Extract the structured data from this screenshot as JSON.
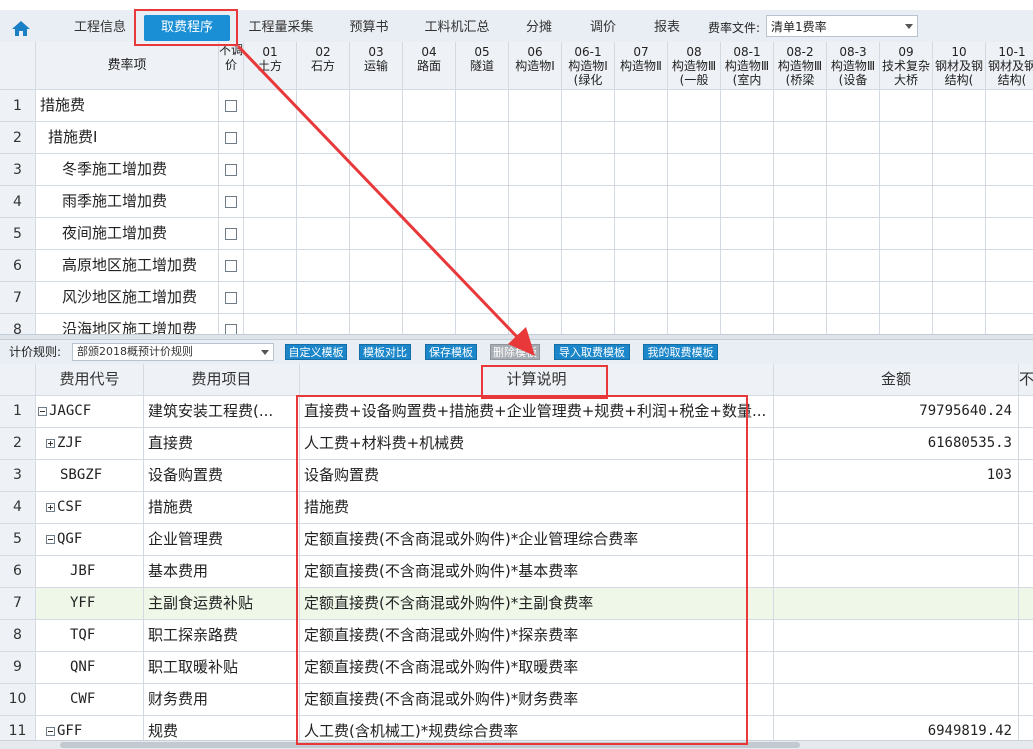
{
  "top_tabs": [
    {
      "label": "工程信息",
      "active": false
    },
    {
      "label": "取费程序",
      "active": true
    },
    {
      "label": "工程量采集",
      "active": false
    },
    {
      "label": "预算书",
      "active": false
    },
    {
      "label": "工料机汇总",
      "active": false
    },
    {
      "label": "分摊",
      "active": false
    },
    {
      "label": "调价",
      "active": false
    },
    {
      "label": "报表",
      "active": false
    }
  ],
  "fee_file": {
    "label": "费率文件:",
    "value": "清单1费率"
  },
  "upper_grid": {
    "name_header": "费率项",
    "not_adjust_header": "不调价",
    "columns": [
      {
        "code": "01",
        "name": "土方"
      },
      {
        "code": "02",
        "name": "石方"
      },
      {
        "code": "03",
        "name": "运输"
      },
      {
        "code": "04",
        "name": "路面"
      },
      {
        "code": "05",
        "name": "隧道"
      },
      {
        "code": "06",
        "name": "构造物Ⅰ"
      },
      {
        "code": "06-1",
        "name": "构造物Ⅰ(绿化"
      },
      {
        "code": "07",
        "name": "构造物Ⅱ"
      },
      {
        "code": "08",
        "name": "构造物Ⅲ(一般"
      },
      {
        "code": "08-1",
        "name": "构造物Ⅲ(室内"
      },
      {
        "code": "08-2",
        "name": "构造物Ⅲ(桥梁"
      },
      {
        "code": "08-3",
        "name": "构造物Ⅲ(设备"
      },
      {
        "code": "09",
        "name": "技术复杂大桥"
      },
      {
        "code": "10",
        "name": "钢材及钢结构("
      },
      {
        "code": "10-1",
        "name": "钢材及钢结构("
      }
    ],
    "rows": [
      {
        "num": "1",
        "name": "措施费",
        "indent": 0
      },
      {
        "num": "2",
        "name": "措施费Ⅰ",
        "indent": 1
      },
      {
        "num": "3",
        "name": "冬季施工增加费",
        "indent": 2
      },
      {
        "num": "4",
        "name": "雨季施工增加费",
        "indent": 2
      },
      {
        "num": "5",
        "name": "夜间施工增加费",
        "indent": 2
      },
      {
        "num": "6",
        "name": "高原地区施工增加费",
        "indent": 2
      },
      {
        "num": "7",
        "name": "风沙地区施工增加费",
        "indent": 2
      },
      {
        "num": "8",
        "name": "沿海地区施工增加费",
        "indent": 2
      }
    ]
  },
  "toolbar": {
    "rule_label": "计价规则:",
    "rule_value": "部颁2018概预计价规则",
    "buttons": [
      {
        "label": "自定义模板",
        "disabled": false
      },
      {
        "label": "模板对比",
        "disabled": false
      },
      {
        "label": "保存模板",
        "disabled": false
      },
      {
        "label": "删除模板",
        "disabled": true
      },
      {
        "label": "导入取费模板",
        "disabled": false
      },
      {
        "label": "我的取费模板",
        "disabled": false
      }
    ]
  },
  "lower_grid": {
    "headers": {
      "code": "费用代号",
      "item": "费用项目",
      "desc": "计算说明",
      "amount": "金额",
      "extra": "不"
    },
    "rows": [
      {
        "num": "1",
        "code": "JAGCF",
        "expander": "minus",
        "indent": 0,
        "item": "建筑安装工程费(...",
        "desc": "直接费+设备购置费+措施费+企业管理费+规费+利润+税金+数量...",
        "amount": "79795640.24"
      },
      {
        "num": "2",
        "code": "ZJF",
        "expander": "plus",
        "indent": 1,
        "item": "直接费",
        "desc": "人工费+材料费+机械费",
        "amount": "61680535.3"
      },
      {
        "num": "3",
        "code": "SBGZF",
        "expander": "",
        "indent": 1,
        "item": "设备购置费",
        "desc": "设备购置费",
        "amount": "103"
      },
      {
        "num": "4",
        "code": "CSF",
        "expander": "plus",
        "indent": 1,
        "item": "措施费",
        "desc": "措施费",
        "amount": ""
      },
      {
        "num": "5",
        "code": "QGF",
        "expander": "minus",
        "indent": 1,
        "item": "企业管理费",
        "desc": "定额直接费(不含商混或外购件)*企业管理综合费率",
        "amount": ""
      },
      {
        "num": "6",
        "code": "JBF",
        "expander": "",
        "indent": 2,
        "item": "基本费用",
        "desc": "定额直接费(不含商混或外购件)*基本费率",
        "amount": ""
      },
      {
        "num": "7",
        "code": "YFF",
        "expander": "",
        "indent": 2,
        "item": "主副食运费补贴",
        "desc": "定额直接费(不含商混或外购件)*主副食费率",
        "amount": "",
        "selected": true
      },
      {
        "num": "8",
        "code": "TQF",
        "expander": "",
        "indent": 2,
        "item": "职工探亲路费",
        "desc": "定额直接费(不含商混或外购件)*探亲费率",
        "amount": ""
      },
      {
        "num": "9",
        "code": "QNF",
        "expander": "",
        "indent": 2,
        "item": "职工取暖补贴",
        "desc": "定额直接费(不含商混或外购件)*取暖费率",
        "amount": ""
      },
      {
        "num": "10",
        "code": "CWF",
        "expander": "",
        "indent": 2,
        "item": "财务费用",
        "desc": "定额直接费(不含商混或外购件)*财务费率",
        "amount": ""
      },
      {
        "num": "11",
        "code": "GFF",
        "expander": "minus",
        "indent": 1,
        "item": "规费",
        "desc": "人工费(含机械工)*规费综合费率",
        "amount": "6949819.42"
      }
    ]
  },
  "colors": {
    "accent": "#1a8fd6",
    "annotation": "#e8383a",
    "selected_row": "#eef7e8"
  }
}
